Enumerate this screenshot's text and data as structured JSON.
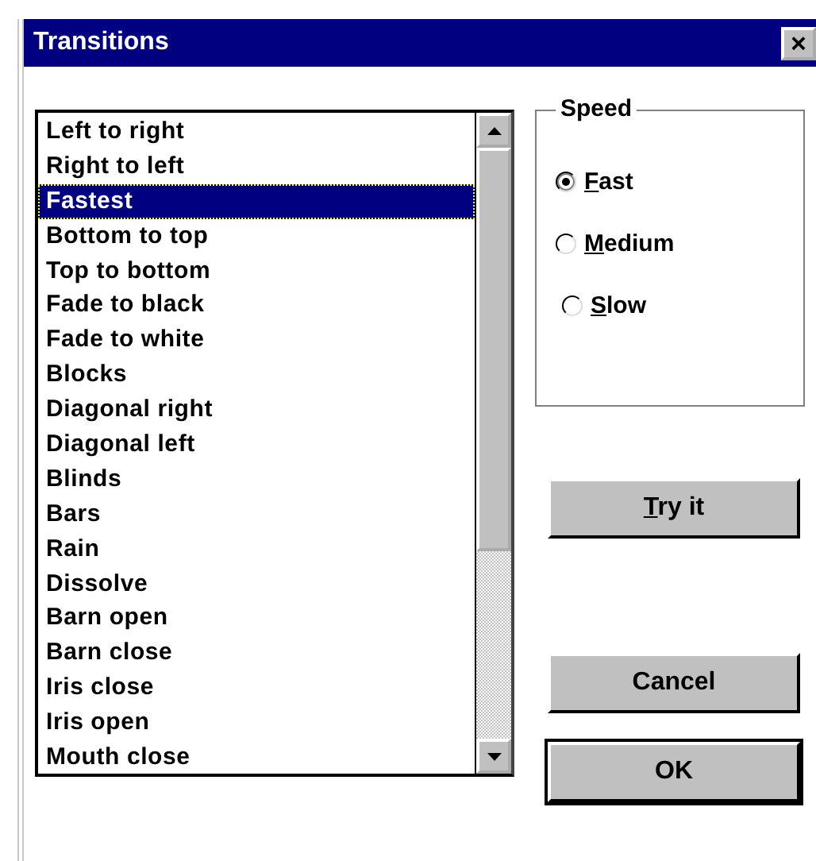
{
  "window": {
    "title": "Transitions",
    "close": "×"
  },
  "list": {
    "items": [
      {
        "label": "Left to right",
        "selected": false
      },
      {
        "label": "Right to left",
        "selected": false
      },
      {
        "label": "Fastest",
        "selected": true
      },
      {
        "label": "Bottom to top",
        "selected": false
      },
      {
        "label": "Top to bottom",
        "selected": false
      },
      {
        "label": "Fade to black",
        "selected": false
      },
      {
        "label": "Fade to white",
        "selected": false
      },
      {
        "label": "Blocks",
        "selected": false
      },
      {
        "label": "Diagonal right",
        "selected": false
      },
      {
        "label": "Diagonal left",
        "selected": false
      },
      {
        "label": "Blinds",
        "selected": false
      },
      {
        "label": "Bars",
        "selected": false
      },
      {
        "label": "Rain",
        "selected": false
      },
      {
        "label": "Dissolve",
        "selected": false
      },
      {
        "label": "Barn open",
        "selected": false
      },
      {
        "label": "Barn close",
        "selected": false
      },
      {
        "label": "Iris close",
        "selected": false
      },
      {
        "label": "Iris open",
        "selected": false
      },
      {
        "label": "Mouth close",
        "selected": false
      }
    ]
  },
  "speed": {
    "title": "Speed",
    "options": [
      {
        "label": "Fast",
        "selected": true,
        "underline_first": true
      },
      {
        "label": "Medium",
        "selected": false,
        "underline_first": true
      },
      {
        "label": "Slow",
        "selected": false,
        "underline_first": true
      }
    ]
  },
  "buttons": [
    {
      "label": "Try it",
      "underline_first": true,
      "default": false
    },
    {
      "label": "Cancel",
      "underline_first": false,
      "default": false
    },
    {
      "label": "OK",
      "underline_first": false,
      "default": true
    }
  ]
}
